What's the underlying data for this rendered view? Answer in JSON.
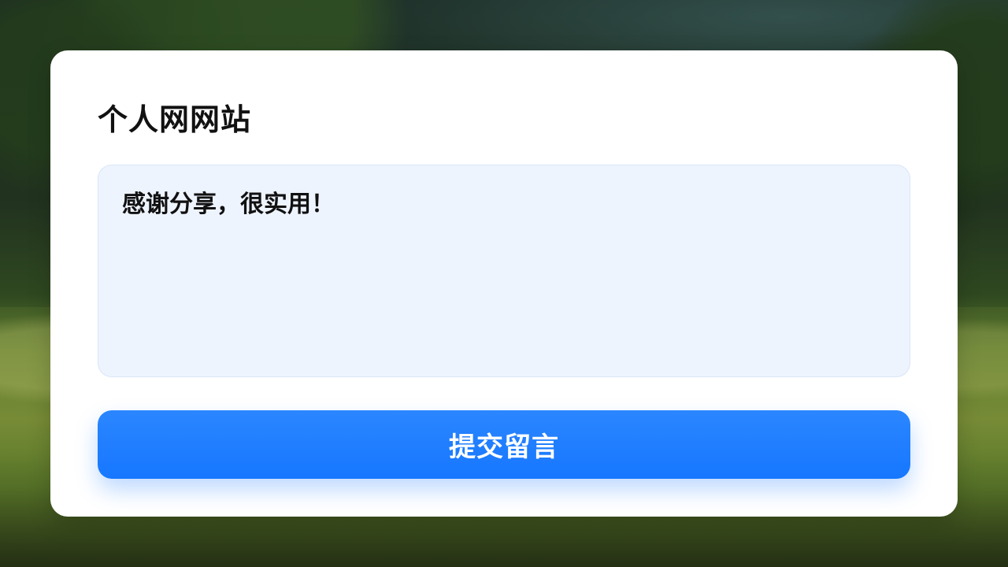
{
  "card": {
    "title": "个人网网站"
  },
  "comment": {
    "text": "感谢分享，很实用！"
  },
  "actions": {
    "submit_label": "提交留言"
  },
  "theme": {
    "primary": "#1677ff",
    "comment_bg": "#eef4fe",
    "card_bg": "#ffffff",
    "title_color": "#111111"
  }
}
